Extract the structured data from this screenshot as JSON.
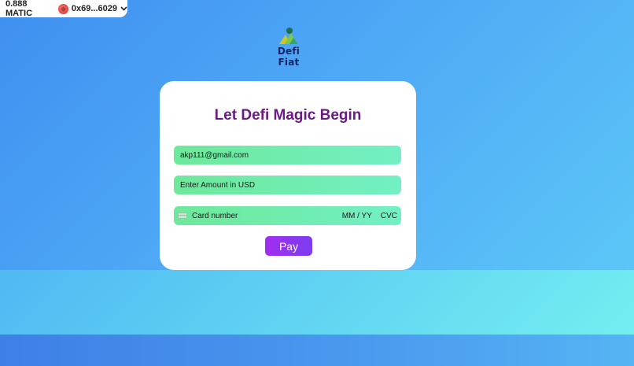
{
  "wallet": {
    "balance": "0.888 MATIC",
    "address": "0x69...6029",
    "chevron": "⌄"
  },
  "brand": {
    "name": "Defi Fiat",
    "icon": "defi-fiat-logo-icon"
  },
  "form": {
    "title": "Let Defi Magic Begin",
    "email_value": "akp111@gmail.com",
    "amount_placeholder": "Enter Amount in USD",
    "card_number_placeholder": "Card number",
    "expiry_placeholder": "MM / YY",
    "cvc_placeholder": "CVC",
    "pay_label": "Pay"
  },
  "colors": {
    "title": "#6b1a82",
    "pay_button": "#9132f0",
    "field": "#70eeb0"
  }
}
